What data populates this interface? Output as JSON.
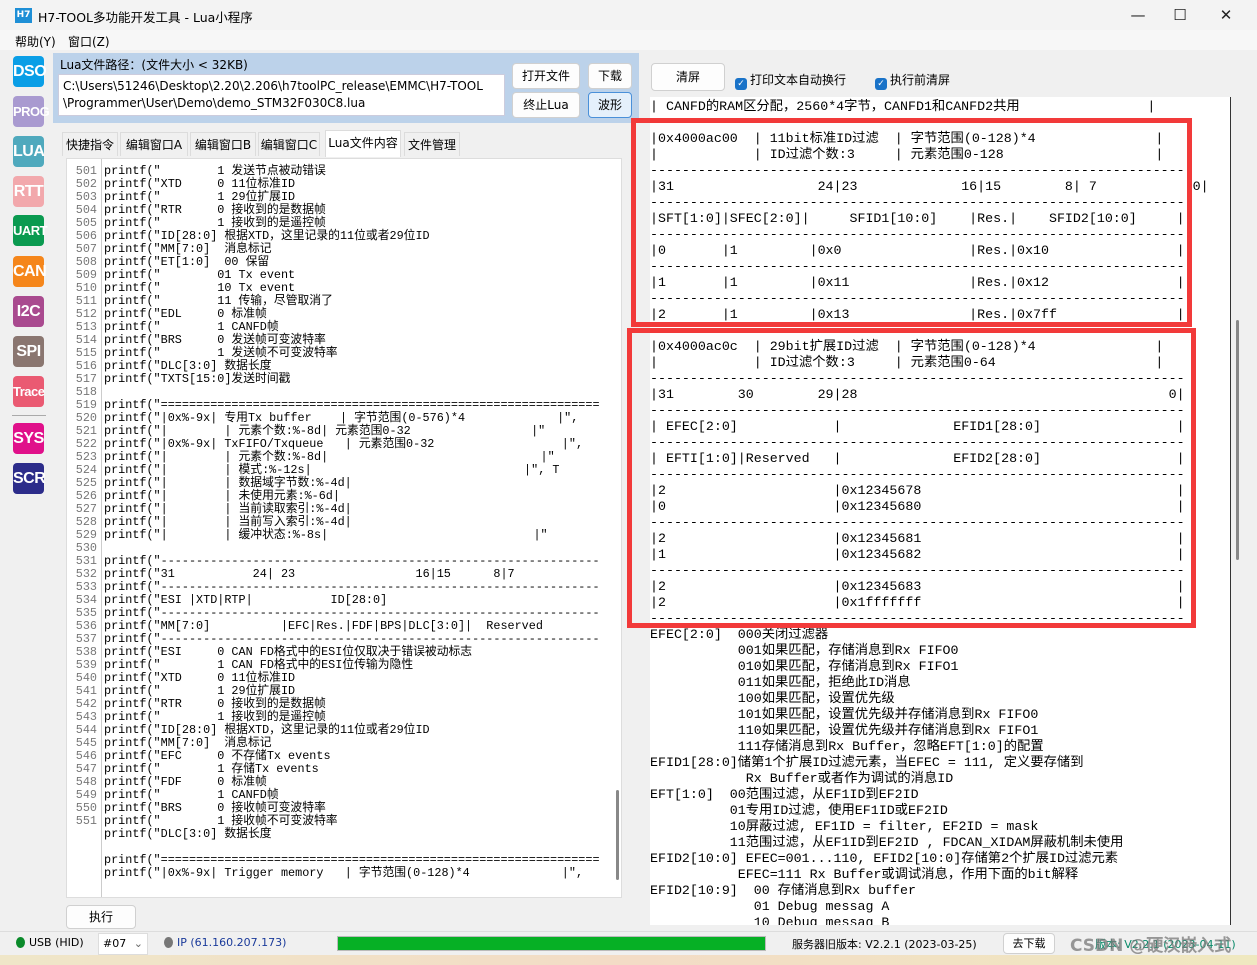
{
  "window": {
    "title": "H7-TOOL多功能开发工具 - Lua小程序",
    "icon": "H7",
    "minimize": "—",
    "maximize": "☐",
    "close": "✕"
  },
  "menu": [
    "帮助(Y)",
    "窗口(Z)"
  ],
  "sidebar": [
    {
      "label": "DSO",
      "color": "#0a9ee6"
    },
    {
      "label": "PROG",
      "color": "#a99ad0"
    },
    {
      "label": "LUA",
      "color": "#4fa9bd"
    },
    {
      "label": "RTT",
      "color": "#f2a8ac"
    },
    {
      "label": "UART",
      "color": "#0a9a50"
    },
    {
      "label": "CAN",
      "color": "#f5861b"
    },
    {
      "label": "I2C",
      "color": "#a94a8f"
    },
    {
      "label": "SPI",
      "color": "#8a7670"
    },
    {
      "label": "Trace",
      "color": "#ea5a72"
    },
    {
      "label": "SYS",
      "color": "#e0108a"
    },
    {
      "label": "SCR",
      "color": "#2c2c8a"
    }
  ],
  "lua_panel": {
    "path_label": "Lua文件路径：(文件大小 < 32KB)",
    "path_value": "C:\\Users\\51246\\Desktop\\2.20\\2.206\\h7toolPC_release\\EMMC\\H7-TOOL\n\\Programmer\\User\\Demo\\demo_STM32F030C8.lua",
    "open_file": "打开文件",
    "download": "下载",
    "stop_lua": "终止Lua",
    "waveform": "波形"
  },
  "tabs": [
    {
      "label": "快捷指令"
    },
    {
      "label": "编辑窗口A"
    },
    {
      "label": "编辑窗口B"
    },
    {
      "label": "编辑窗口C"
    },
    {
      "label": "Lua文件内容",
      "active": true
    },
    {
      "label": "文件管理"
    }
  ],
  "code": [
    {
      "n": "501",
      "t": "printf(\"        1 发送节点被动错误"
    },
    {
      "n": "502",
      "t": "printf(\"XTD     0 11位标准ID"
    },
    {
      "n": "503",
      "t": "printf(\"        1 29位扩展ID"
    },
    {
      "n": "504",
      "t": "printf(\"RTR     0 接收到的是数据帧"
    },
    {
      "n": "505",
      "t": "printf(\"        1 接收到的是遥控帧"
    },
    {
      "n": "506",
      "t": "printf(\"ID[28:0] 根据XTD，这里记录的11位或者29位ID"
    },
    {
      "n": "507",
      "t": "printf(\"MM[7:0]  消息标记"
    },
    {
      "n": "508",
      "t": "printf(\"ET[1:0]  00 保留"
    },
    {
      "n": "509",
      "t": "printf(\"        01 Tx event"
    },
    {
      "n": "510",
      "t": "printf(\"        10 Tx event"
    },
    {
      "n": "511",
      "t": "printf(\"        11 传输，尽管取消了"
    },
    {
      "n": "512",
      "t": "printf(\"EDL     0 标准帧"
    },
    {
      "n": "513",
      "t": "printf(\"        1 CANFD帧"
    },
    {
      "n": "514",
      "t": "printf(\"BRS     0 发送帧可变波特率"
    },
    {
      "n": "515",
      "t": "printf(\"        1 发送帧不可变波特率"
    },
    {
      "n": "516",
      "t": "printf(\"DLC[3:0] 数据长度"
    },
    {
      "n": "517",
      "t": "printf(\"TXTS[15:0]发送时间戳"
    },
    {
      "n": "518",
      "t": ""
    },
    {
      "n": "519",
      "t": "printf(\"=============================================================="
    },
    {
      "n": "520",
      "t": "printf(\"|0x%-9x| 专用Tx buffer    | 字节范围(0-576)*4             |\","
    },
    {
      "n": "521",
      "t": "printf(\"|        | 元素个数:%-8d| 元素范围0-32                 |\""
    },
    {
      "n": "522",
      "t": "printf(\"|0x%-9x| TxFIFO/Txqueue   | 元素范围0-32                  |\","
    },
    {
      "n": "523",
      "t": "printf(\"|        | 元素个数:%-8d|                              |\""
    },
    {
      "n": "524",
      "t": "printf(\"|        | 模式:%-12s|                              |\", T"
    },
    {
      "n": "525",
      "t": "printf(\"|        | 数据域字节数:%-4d|"
    },
    {
      "n": "526",
      "t": "printf(\"|        | 未使用元素:%-6d|"
    },
    {
      "n": "527",
      "t": "printf(\"|        | 当前读取索引:%-4d|"
    },
    {
      "n": "528",
      "t": "printf(\"|        | 当前写入索引:%-4d|"
    },
    {
      "n": "529",
      "t": "printf(\"|        | 缓冲状态:%-8s|                             |\""
    },
    {
      "n": "530",
      "t": ""
    },
    {
      "n": "531",
      "t": "printf(\"--------------------------------------------------------------"
    },
    {
      "n": "532",
      "t": "printf(\"31           24| 23                 16|15      8|7"
    },
    {
      "n": "533",
      "t": "printf(\"--------------------------------------------------------------"
    },
    {
      "n": "534",
      "t": "printf(\"ESI |XTD|RTP|           ID[28:0]"
    },
    {
      "n": "535",
      "t": "printf(\"--------------------------------------------------------------"
    },
    {
      "n": "536",
      "t": "printf(\"MM[7:0]          |EFC|Res.|FDF|BPS|DLC[3:0]|  Reserved"
    },
    {
      "n": "537",
      "t": "printf(\"--------------------------------------------------------------"
    },
    {
      "n": "538",
      "t": "printf(\"ESI     0 CAN FD格式中的ESI位仅取决于错误被动标志"
    },
    {
      "n": "539",
      "t": "printf(\"        1 CAN FD格式中的ESI位传输为隐性"
    },
    {
      "n": "540",
      "t": "printf(\"XTD     0 11位标准ID"
    },
    {
      "n": "541",
      "t": "printf(\"        1 29位扩展ID"
    },
    {
      "n": "542",
      "t": "printf(\"RTR     0 接收到的是数据帧"
    },
    {
      "n": "543",
      "t": "printf(\"        1 接收到的是遥控帧"
    },
    {
      "n": "544",
      "t": "printf(\"ID[28:0] 根据XTD，这里记录的11位或者29位ID"
    },
    {
      "n": "545",
      "t": "printf(\"MM[7:0]  消息标记"
    },
    {
      "n": "546",
      "t": "printf(\"EFC     0 不存储Tx events"
    },
    {
      "n": "547",
      "t": "printf(\"        1 存储Tx events"
    },
    {
      "n": "548",
      "t": "printf(\"FDF     0 标准帧"
    },
    {
      "n": "549",
      "t": "printf(\"        1 CANFD帧"
    },
    {
      "n": "550",
      "t": "printf(\"BRS     0 接收帧可变波特率"
    },
    {
      "n": "551",
      "t": "printf(\"        1 接收帧不可变波特率"
    },
    {
      "n": "",
      "t": "printf(\"DLC[3:0] 数据长度"
    },
    {
      "n": "",
      "t": ""
    },
    {
      "n": "",
      "t": "printf(\"=============================================================="
    },
    {
      "n": "",
      "t": "printf(\"|0x%-9x| Trigger memory   | 字节范围(0-128)*4             |\","
    }
  ],
  "run_button": "执行",
  "output_toolbar": {
    "clear": "清屏",
    "auto_wrap": "打印文本自动换行",
    "auto_wrap_checked": true,
    "clear_before_run": "执行前清屏",
    "clear_before_run_checked": true
  },
  "output_lines": [
    "| CANFD的RAM区分配，2560*4字节，CANFD1和CANFD2共用                |",
    "-------------------------------------------------------------------",
    "|0x4000ac00  | 11bit标准ID过滤  | 字节范围(0-128)*4               |",
    "|            | ID过滤个数:3     | 元素范围0-128                   |",
    "-------------------------------------------------------------------",
    "|31                  24|23             16|15        8| 7            0|",
    "-------------------------------------------------------------------",
    "|SFT[1:0]|SFEC[2:0]|     SFID1[10:0]    |Res.|    SFID2[10:0]     |",
    "-------------------------------------------------------------------",
    "|0       |1         |0x0                |Res.|0x10                |",
    "-------------------------------------------------------------------",
    "|1       |1         |0x11               |Res.|0x12                |",
    "-------------------------------------------------------------------",
    "|2       |1         |0x13               |Res.|0x7ff               ||",
    "-------------------------------------------------------------------",
    "|0x4000ac0c  | 29bit扩展ID过滤  | 字节范围(0-128)*4               |",
    "|            | ID过滤个数:3     | 元素范围0-64                    |",
    "-------------------------------------------------------------------",
    "|31        30        29|28                                       0|",
    "-------------------------------------------------------------------",
    "| EFEC[2:0]            |              EFID1[28:0]                 |",
    "-------------------------------------------------------------------",
    "| EFTI[1:0]|Reserved   |              EFID2[28:0]                 |",
    "-------------------------------------------------------------------",
    "|2                     |0x12345678                                |",
    "|0                     |0x12345680                                |",
    "-------------------------------------------------------------------",
    "|2                     |0x12345681                                |",
    "|1                     |0x12345682                                |",
    "-------------------------------------------------------------------",
    "|2                     |0x12345683                                |",
    "|2                     |0x1fffffff                                |",
    "-------------------------------------------------------------------",
    "EFEC[2:0]  000关闭过滤器",
    "           001如果匹配，存储消息到Rx FIFO0",
    "           010如果匹配，存储消息到Rx FIFO1",
    "           011如果匹配，拒绝此ID消息",
    "           100如果匹配，设置优先级",
    "           101如果匹配，设置优先级并存储消息到Rx FIFO0",
    "           110如果匹配，设置优先级并存储消息到Rx FIFO1",
    "           111存储消息到Rx Buffer，忽略EFT[1:0]的配置",
    "EFID1[28:0]储第1个扩展ID过滤元素，当EFEC = 111, 定义要存储到",
    "            Rx Buffer或者作为调试的消息ID",
    "EFT[1:0]  00范围过滤，从EF1ID到EF2ID",
    "          01专用ID过滤，使用EF1ID或EF2ID",
    "          10屏蔽过滤, EF1ID = filter, EF2ID = mask",
    "          11范围过滤，从EF1ID到EF2ID , FDCAN_XIDAM屏蔽机制未使用",
    "EFID2[10:0] EFEC=001...110, EFID2[10:0]存储第2个扩展ID过滤元素",
    "           EFEC=111 Rx Buffer或调试消息，作用下面的bit解释",
    "EFID2[10:9]  00 存储消息到Rx buffer",
    "             01 Debug messag A",
    "             10 Debug messag B"
  ],
  "status": {
    "usb": "USB (HID)",
    "usb_color": "#0a8a2a",
    "port": "#07",
    "ip": "IP (61.160.207.173)",
    "progress_percent": 100,
    "progress_color": "#06b025",
    "server_version": "服务器旧版本: V2.2.1 (2023-03-25)",
    "goto_download": "去下载",
    "local_version": "版本: V2.2.1 (2023-04-11)",
    "watermark": "CSDN @硬汉嵌入式"
  },
  "highlight_color": "#f23a3a"
}
